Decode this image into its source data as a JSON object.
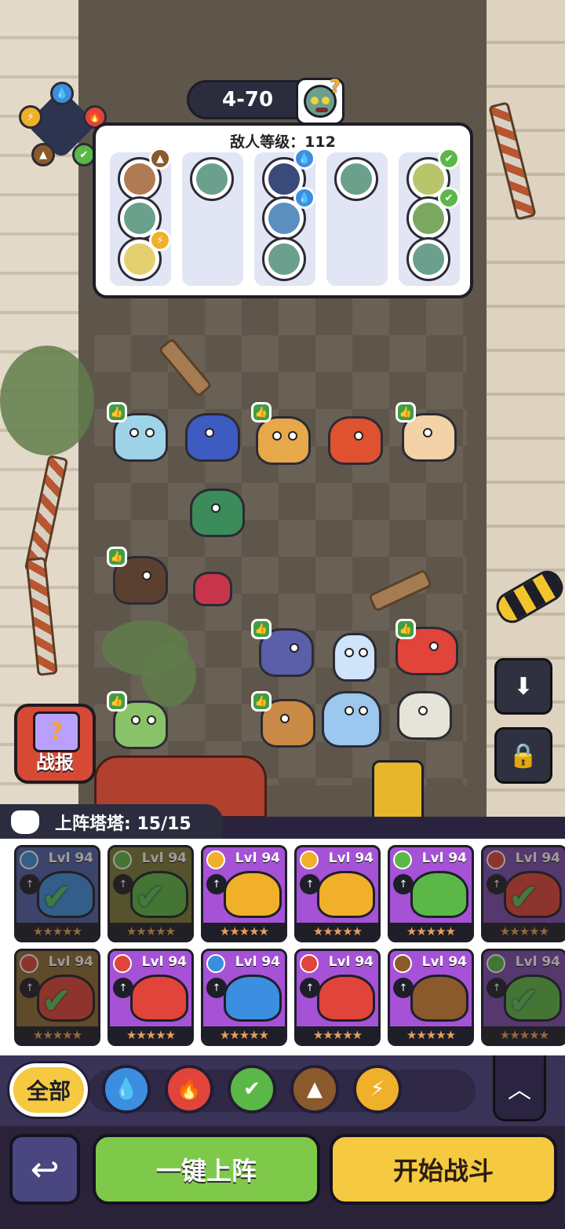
{
  "stage": {
    "level": "4-70"
  },
  "enemy_panel": {
    "title": "敌人等级：112"
  },
  "report_button": {
    "label": "战报"
  },
  "roster": {
    "title": "上阵塔塔: 15/15"
  },
  "cards": [
    {
      "level": "Lvl 94",
      "element": "water",
      "color": "#4e5fa9",
      "deployed": true
    },
    {
      "level": "Lvl 94",
      "element": "grass",
      "color": "#7b7a3a",
      "deployed": true
    },
    {
      "level": "Lvl 94",
      "element": "electric",
      "color": "#a552d6",
      "deployed": false
    },
    {
      "level": "Lvl 94",
      "element": "electric",
      "color": "#a552d6",
      "deployed": false
    },
    {
      "level": "Lvl 94",
      "element": "grass",
      "color": "#a552d6",
      "deployed": false
    },
    {
      "level": "Lvl 94",
      "element": "fire",
      "color": "#7a4ab0",
      "deployed": true
    },
    {
      "level": "Lvl 94",
      "element": "fire",
      "color": "#8c6a34",
      "deployed": true
    },
    {
      "level": "Lvl 94",
      "element": "fire",
      "color": "#a552d6",
      "deployed": false
    },
    {
      "level": "Lvl 94",
      "element": "water",
      "color": "#a552d6",
      "deployed": false
    },
    {
      "level": "Lvl 94",
      "element": "fire",
      "color": "#a552d6",
      "deployed": false
    },
    {
      "level": "Lvl 94",
      "element": "earth",
      "color": "#a552d6",
      "deployed": false
    },
    {
      "level": "Lvl 94",
      "element": "grass",
      "color": "#7a4ab0",
      "deployed": true
    }
  ],
  "filters": {
    "all_label": "全部"
  },
  "buttons": {
    "auto_deploy": "一键上阵",
    "start_battle": "开始战斗"
  },
  "colors": {
    "water": "#3c8ee0",
    "fire": "#e0443a",
    "grass": "#5bb848",
    "earth": "#8a5a2c",
    "electric": "#f0b02a",
    "green_button": "#7fc94a",
    "yellow_button": "#f5c940"
  },
  "icons": [
    "water-icon",
    "fire-icon",
    "grass-icon",
    "earth-icon",
    "electric-icon",
    "download-icon",
    "lock-icon",
    "back-arrow-icon",
    "chevron-up-icon"
  ]
}
